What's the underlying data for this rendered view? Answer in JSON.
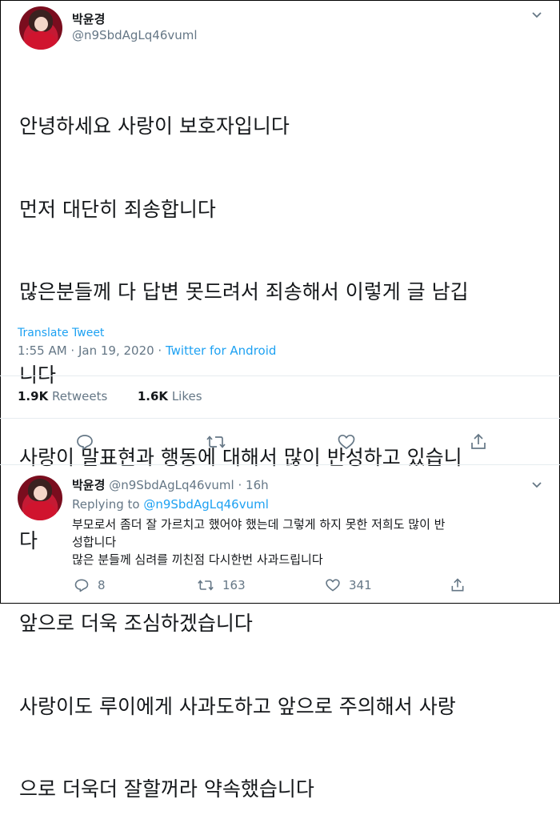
{
  "tweet": {
    "author_name": "박윤경",
    "author_handle": "@n9SbdAgLq46vuml",
    "text_lines": [
      "안녕하세요 사랑이 보호자입니다",
      "먼저 대단히 죄송합니다",
      "많은분들께 다 답변 못드려서 죄송해서 이렇게 글 남깁",
      "니다",
      "사랑이 말표현과 행동에 대해서 많이 반성하고 있습니",
      "다",
      "앞으로 더욱 조심하겠습니다",
      "사랑이도 루이에게 사과도하고 앞으로 주의해서 사랑",
      "으로 더욱더 잘할꺼라 약속했습니다"
    ],
    "translate_label": "Translate Tweet",
    "time": "1:55 AM",
    "date": "Jan 19, 2020",
    "source": "Twitter for Android",
    "separator": " · ",
    "retweets_count": "1.9K",
    "retweets_label": "Retweets",
    "likes_count": "1.6K",
    "likes_label": "Likes",
    "icons": [
      "reply-icon",
      "retweet-icon",
      "like-icon",
      "share-icon"
    ]
  },
  "reply": {
    "author_name": "박윤경",
    "author_handle": "@n9SbdAgLq46vuml",
    "age": "16h",
    "separator": " · ",
    "replying_label": "Replying to ",
    "replying_to": "@n9SbdAgLq46vuml",
    "text_lines": [
      "부모로서 좀더 잘 가르치고 했어야 했는데 그렇게 하지 못한 저희도 많이 반",
      "성합니다",
      "많은 분들께 심려를 끼친점 다시한번 사과드립니다"
    ],
    "reply_count": "8",
    "retweet_count": "163",
    "like_count": "341"
  },
  "colors": {
    "accent": "#1da1f2",
    "muted": "#657786",
    "text": "#14171a"
  }
}
